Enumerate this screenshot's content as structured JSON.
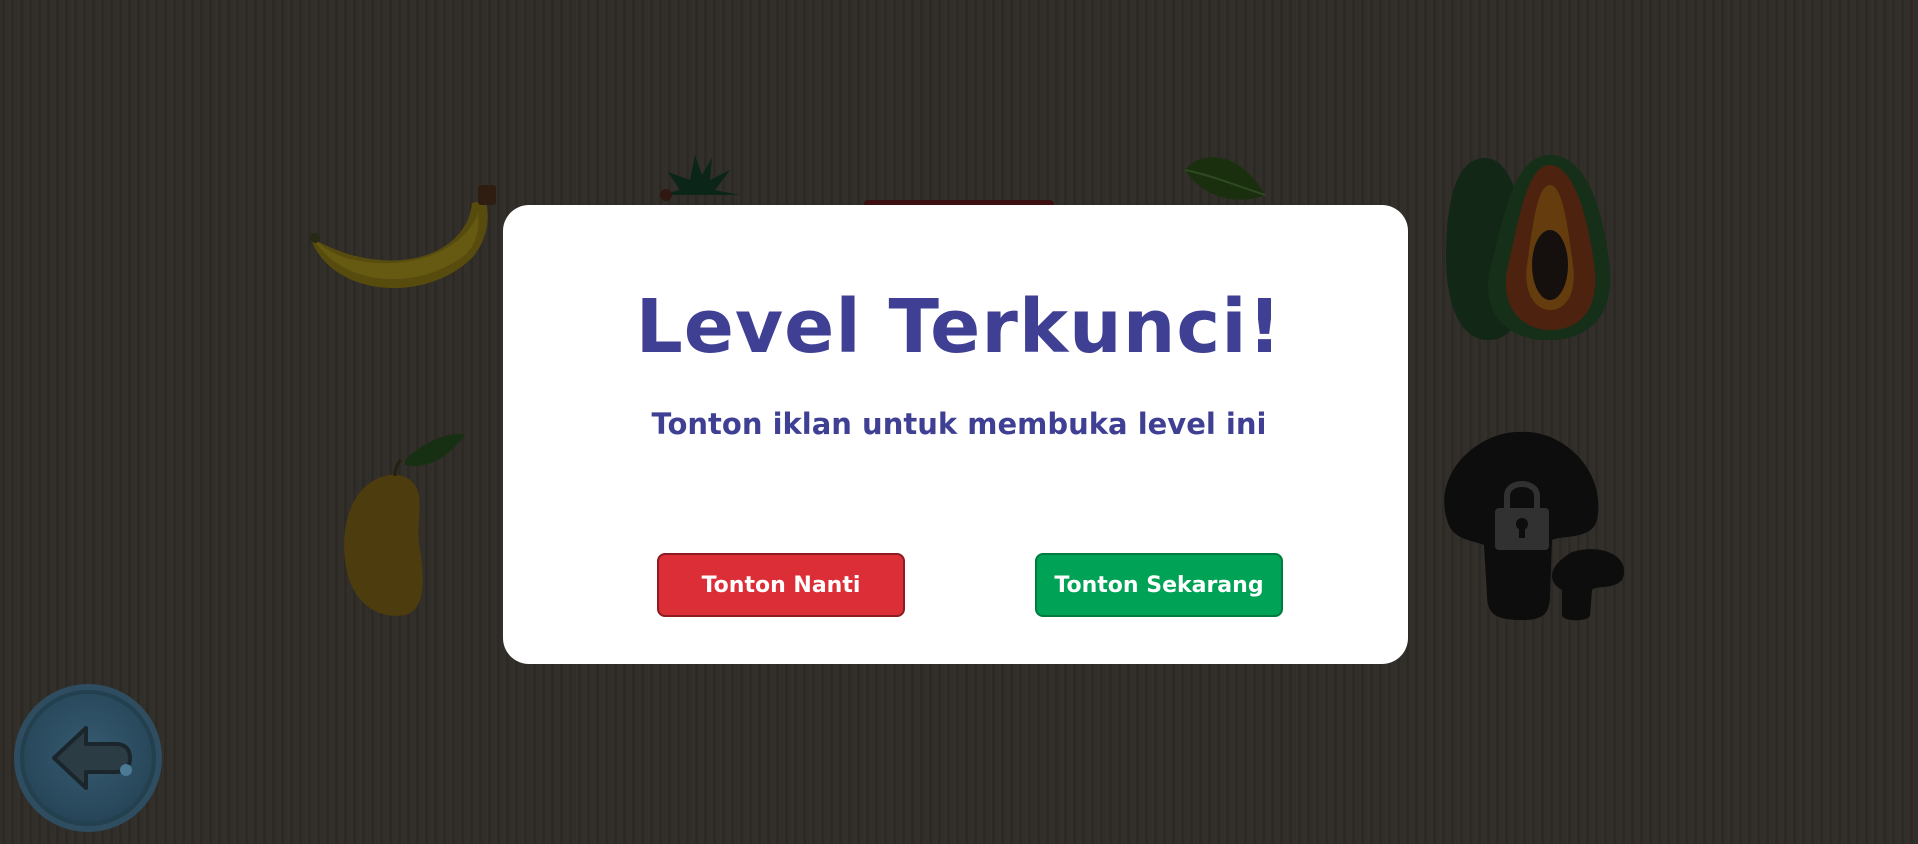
{
  "dialog": {
    "title": "Level Terkunci!",
    "message": "Tonton iklan untuk membuka level ini",
    "later_button": "Tonton Nanti",
    "now_button": "Tonton Sekarang"
  },
  "levels": [
    {
      "name": "banana",
      "locked": false
    },
    {
      "name": "pineapple",
      "locked": false
    },
    {
      "name": "red-fruit",
      "locked": false
    },
    {
      "name": "green-fruit",
      "locked": false
    },
    {
      "name": "papaya",
      "locked": false
    },
    {
      "name": "mango",
      "locked": false
    },
    {
      "name": "mushroom",
      "locked": true
    }
  ],
  "nav": {
    "back_icon": "arrow-left-icon"
  },
  "colors": {
    "title": "#3f3f94",
    "later_button": "#dc2e36",
    "now_button": "#00a356",
    "background": "#3a3630"
  }
}
